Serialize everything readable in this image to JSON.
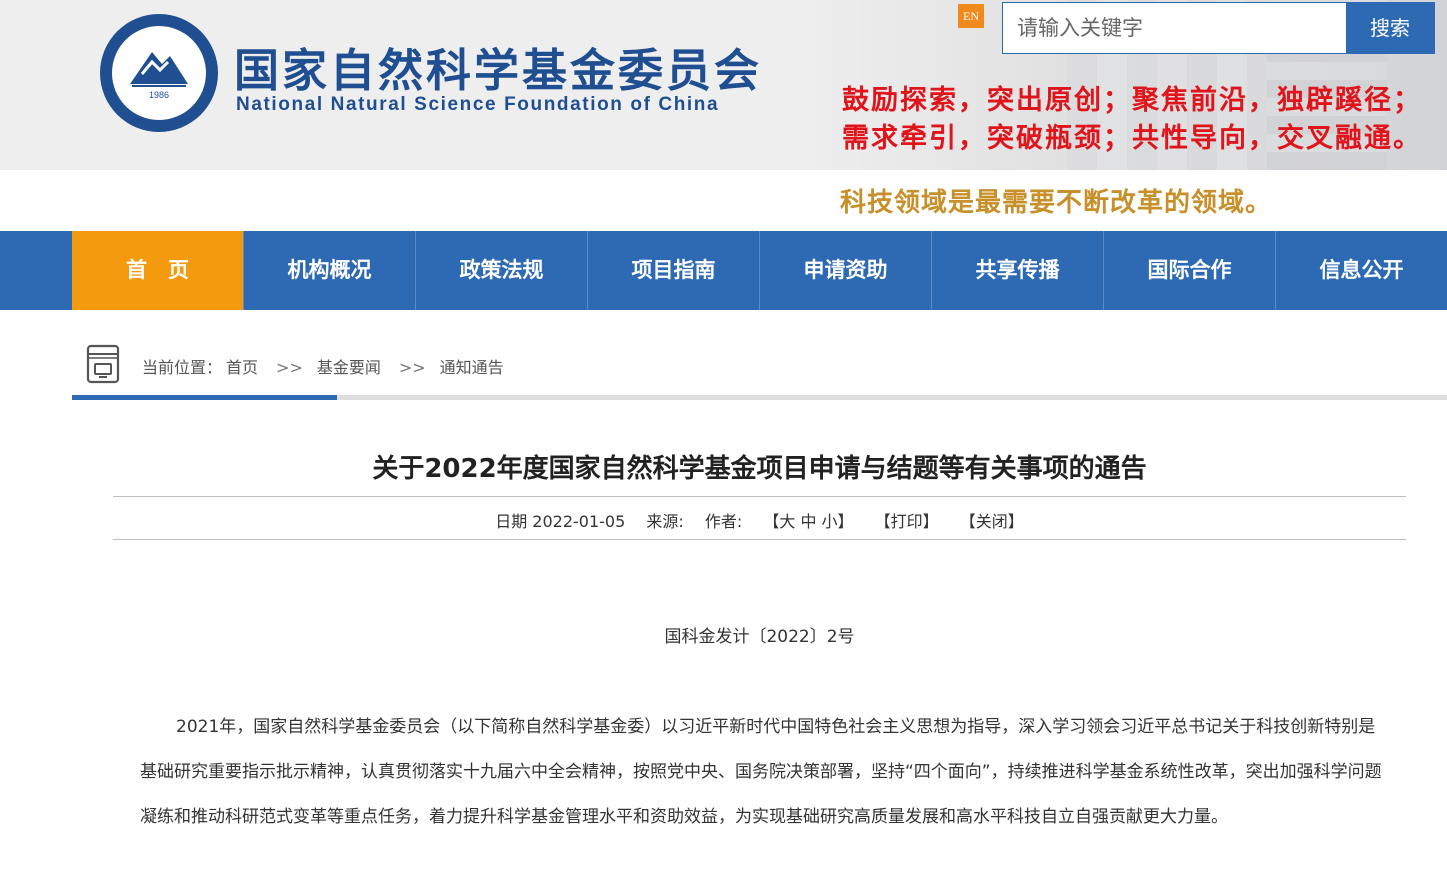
{
  "header": {
    "title_cn": "国家自然科学基金委员会",
    "title_en": "National Natural Science Foundation of China",
    "logo_year": "1986",
    "en_label": "EN",
    "slogan_line1": "鼓励探索，突出原创；聚焦前沿，独辟蹊径；",
    "slogan_line2": "需求牵引，突破瓶颈；共性导向，交叉融通。",
    "slogan_line3": "科技领域是最需要不断改革的领域。"
  },
  "search": {
    "placeholder": "请输入关键字",
    "button_label": "搜索"
  },
  "nav": {
    "items": [
      {
        "label": "首　页"
      },
      {
        "label": "机构概况"
      },
      {
        "label": "政策法规"
      },
      {
        "label": "项目指南"
      },
      {
        "label": "申请资助"
      },
      {
        "label": "共享传播"
      },
      {
        "label": "国际合作"
      },
      {
        "label": "信息公开"
      }
    ]
  },
  "breadcrumb": {
    "prefix": "当前位置：",
    "items": [
      "首页",
      "基金要闻",
      "通知通告"
    ],
    "separator": ">>"
  },
  "article": {
    "title": "关于2022年度国家自然科学基金项目申请与结题等有关事项的通告",
    "date_label": "日期 2022-01-05",
    "source_label": "来源:",
    "author_label": "作者:",
    "font_size_label": "【大 中 小】",
    "print_label": "【打印】",
    "close_label": "【关闭】",
    "doc_number": "国科金发计〔2022〕2号",
    "paragraph": "2021年，国家自然科学基金委员会（以下简称自然科学基金委）以习近平新时代中国特色社会主义思想为指导，深入学习领会习近平总书记关于科技创新特别是基础研究重要指示批示精神，认真贯彻落实十九届六中全会精神，按照党中央、国务院决策部署，坚持“四个面向”，持续推进科学基金系统性改革，突出加强科学问题凝练和推动科研范式变革等重点任务，着力提升科学基金管理水平和资助效益，为实现基础研究高质量发展和高水平科技自立自强贡献更大力量。"
  },
  "colors": {
    "brand_blue": "#2e6ab4",
    "nav_active": "#f39a0f",
    "slogan_red": "#e0151b",
    "slogan_gold": "#c7902a"
  }
}
